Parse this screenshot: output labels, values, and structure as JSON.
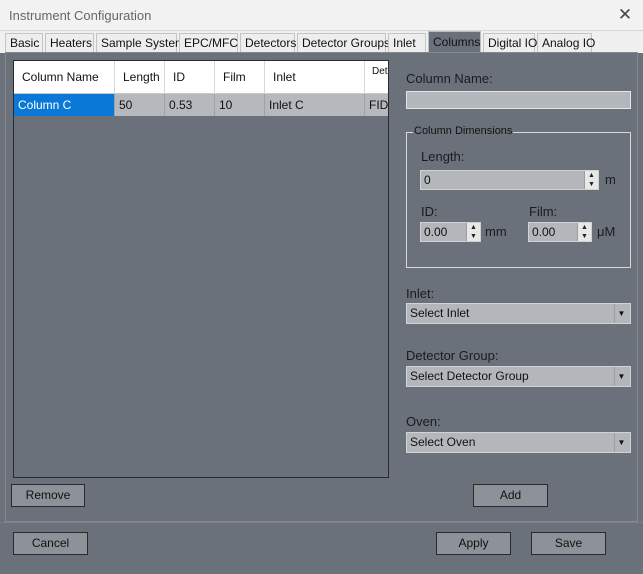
{
  "window": {
    "title": "Instrument Configuration"
  },
  "tabs": [
    {
      "label": "Basic"
    },
    {
      "label": "Heaters"
    },
    {
      "label": "Sample System"
    },
    {
      "label": "EPC/MFC"
    },
    {
      "label": "Detectors"
    },
    {
      "label": "Detector Groups"
    },
    {
      "label": "Inlet"
    },
    {
      "label": "Columns"
    },
    {
      "label": "Digital IO"
    },
    {
      "label": "Analog IO"
    }
  ],
  "grid": {
    "headers": [
      "Column Name",
      "Length",
      "ID",
      "Film",
      "Inlet",
      "Det Gro"
    ],
    "rows": [
      {
        "name": "Column C",
        "length": "50",
        "id": "0.53",
        "film": "10",
        "inlet": "Inlet C",
        "detector": "FID"
      }
    ]
  },
  "form": {
    "column_name_label": "Column Name:",
    "column_name_value": "",
    "dimensions_legend": "Column Dimensions",
    "length_label": "Length:",
    "length_value": "0",
    "length_unit": "m",
    "id_label": "ID:",
    "id_value": "0.00",
    "id_unit": "mm",
    "film_label": "Film:",
    "film_value": "0.00",
    "film_unit": "μM",
    "inlet_label": "Inlet:",
    "inlet_value": "Select Inlet",
    "detector_group_label": "Detector Group:",
    "detector_group_value": "Select Detector Group",
    "oven_label": "Oven:",
    "oven_value": "Select Oven"
  },
  "buttons": {
    "remove": "Remove",
    "add": "Add",
    "cancel": "Cancel",
    "apply": "Apply",
    "save": "Save"
  },
  "icons": {
    "close": "close-icon",
    "spin_up": "arrow-up-icon",
    "spin_down": "arrow-down-icon",
    "dropdown": "chevron-down-icon"
  }
}
